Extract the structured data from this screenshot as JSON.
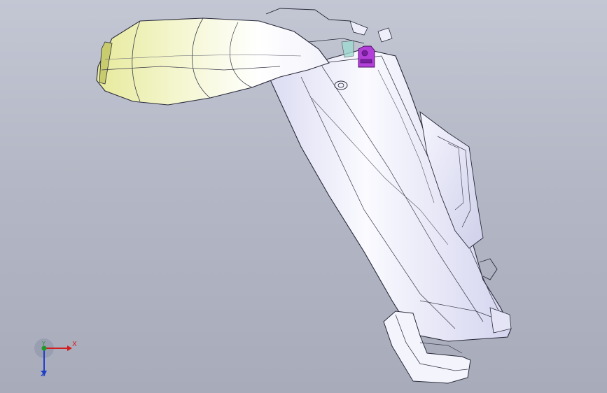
{
  "viewport": {
    "triad": {
      "x_label": "X",
      "y_label": "Y",
      "z_label": "Z"
    },
    "colors": {
      "x_axis": "#d21e1e",
      "y_axis": "#1f9a2a",
      "z_axis": "#1f3fc9",
      "part_body": "#eeeefb",
      "part_intake": "#eef0c4",
      "part_bracket": "#b23fd8"
    },
    "model_parts": [
      "intake-duct",
      "main-housing",
      "mount-bracket",
      "bottom-foot",
      "side-flange"
    ]
  }
}
